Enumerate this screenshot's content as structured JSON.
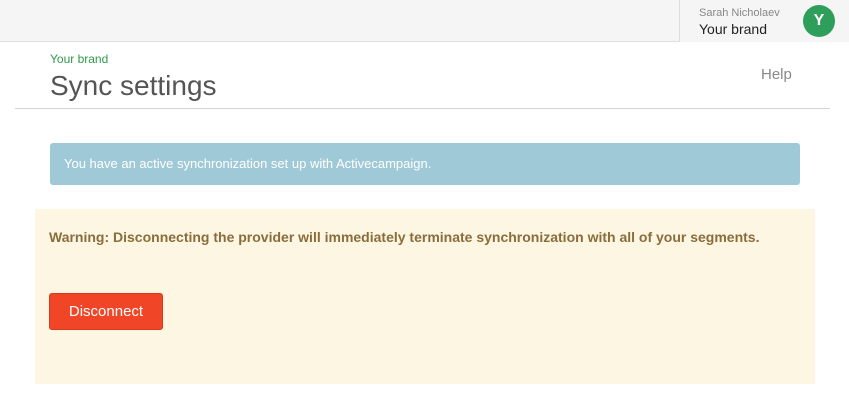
{
  "header": {
    "user_name": "Sarah Nicholaev",
    "brand": "Your brand",
    "avatar_initial": "Y",
    "avatar_color": "#2e9e5b"
  },
  "page": {
    "breadcrumb": "Your brand",
    "title": "Sync settings",
    "help_label": "Help"
  },
  "info_alert": {
    "text": "You have an active synchronization set up with Activecampaign."
  },
  "warning": {
    "text": "Warning: Disconnecting the provider will immediately terminate synchronization with all of your segments.",
    "button_label": "Disconnect",
    "button_color": "#f04627"
  }
}
